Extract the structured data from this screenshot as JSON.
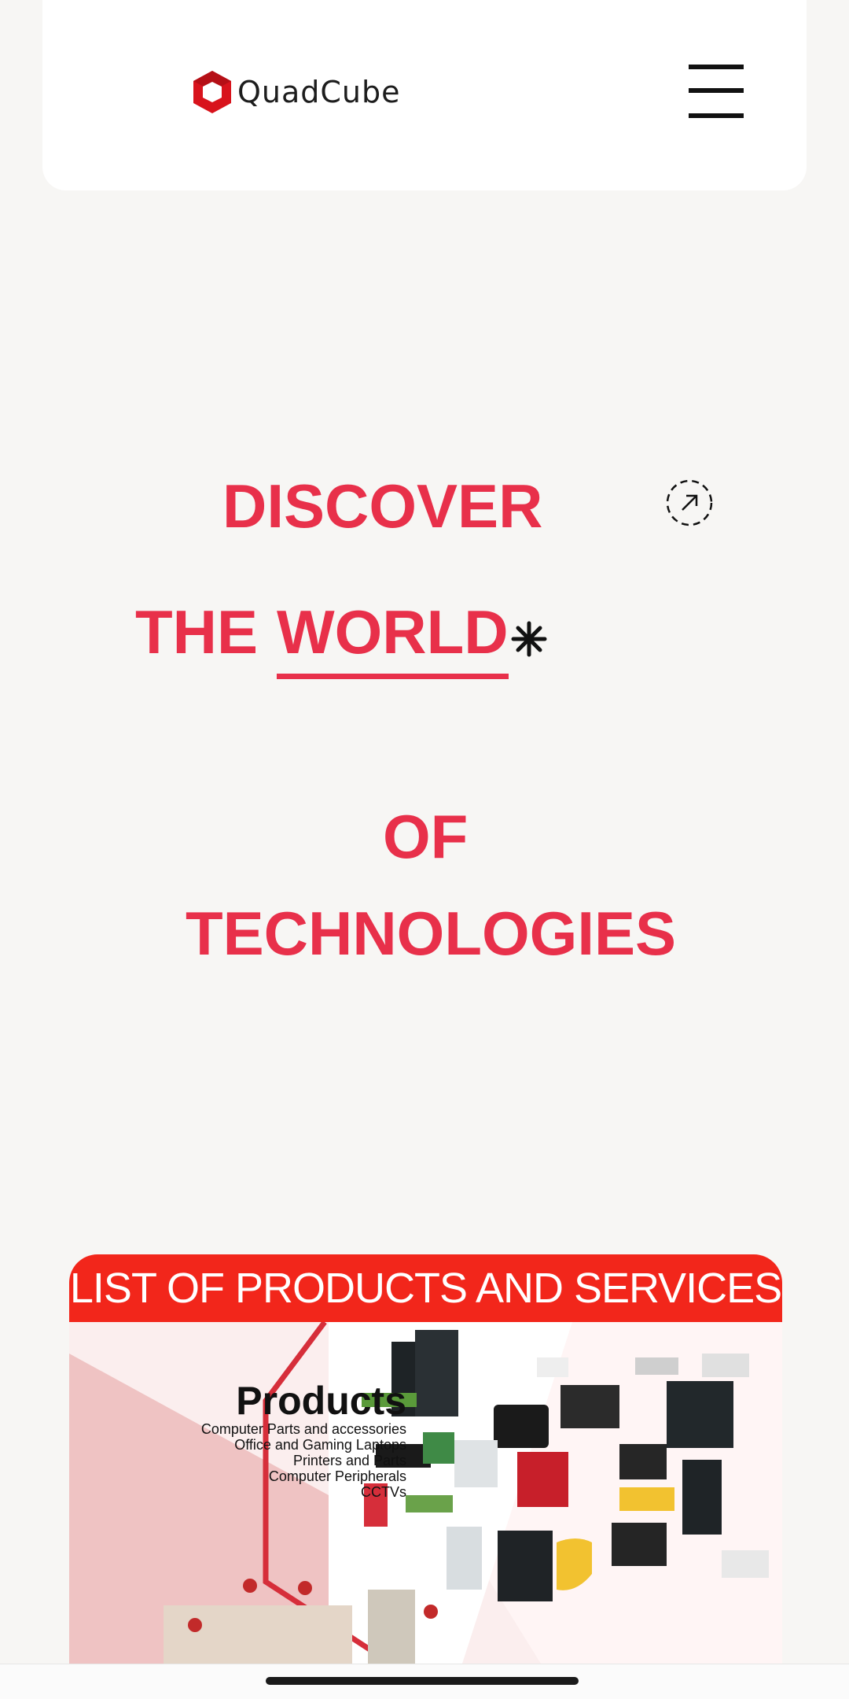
{
  "header": {
    "brand": "QuadCube",
    "menu_icon": "hamburger-menu-icon"
  },
  "hero": {
    "line1": "DISCOVER",
    "line2_prefix": "THE",
    "line2_highlight": "WORLD",
    "line3": "OF",
    "line4": "TECHNOLOGIES",
    "accent_color": "#e8304a",
    "arrow_icon": "external-arrow-icon",
    "star_icon": "asterisk-star-icon"
  },
  "banner": {
    "title": "LIST OF PRODUCTS AND SERVICES",
    "products_title": "Products",
    "products": [
      "Computer Parts and accessories",
      "Office and Gaming Laptops",
      "Printers and Parts",
      "Computer Peripherals",
      "CCTVs"
    ],
    "header_color": "#f2261b"
  }
}
